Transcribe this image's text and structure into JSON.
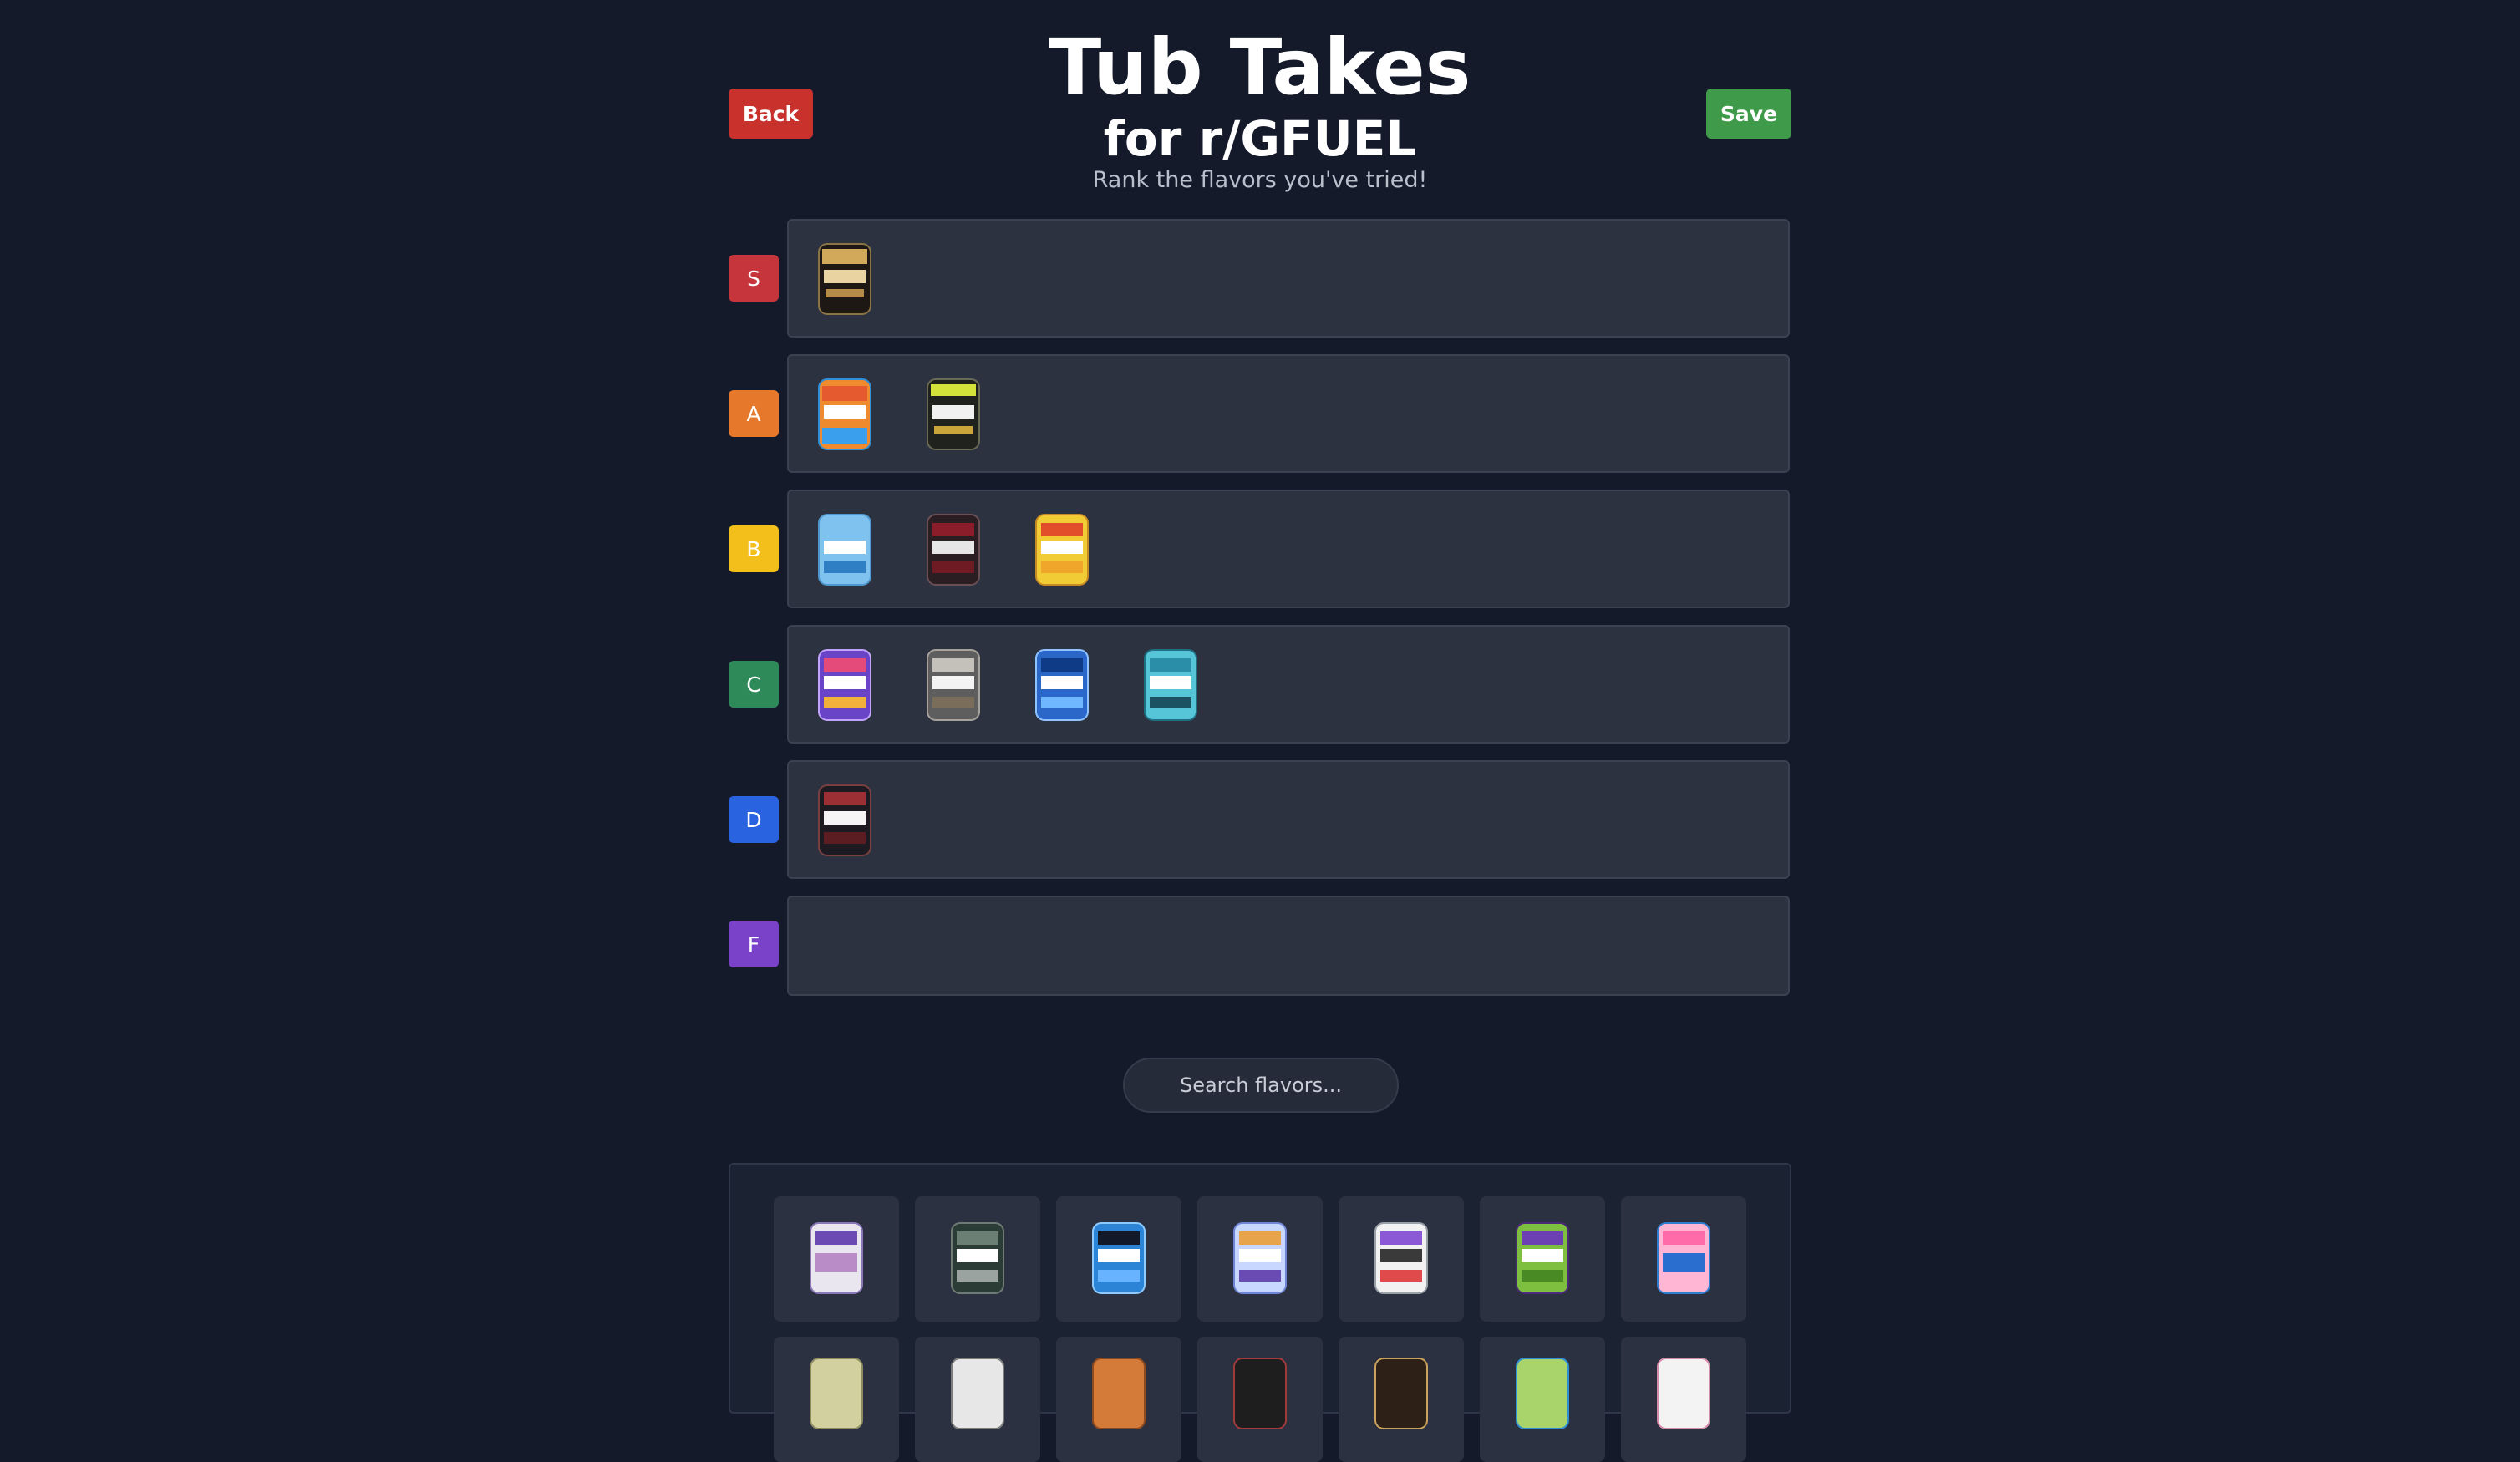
{
  "header": {
    "title": "Tub Takes",
    "subtitle": "for r/GFUEL",
    "tagline": "Rank the flavors you've tried!",
    "back_label": "Back",
    "save_label": "Save"
  },
  "tiers": [
    {
      "label": "S",
      "color": "#c7353c",
      "items": [
        {
          "icon": "gfuel-tub-black-gold"
        }
      ]
    },
    {
      "label": "A",
      "color": "#e5782a",
      "items": [
        {
          "icon": "gfuel-tub-orange-blue"
        },
        {
          "icon": "gfuel-tub-black-yellow"
        }
      ]
    },
    {
      "label": "B",
      "color": "#f3c01b",
      "items": [
        {
          "icon": "gfuel-tub-light-blue"
        },
        {
          "icon": "gfuel-tub-dark-red"
        },
        {
          "icon": "gfuel-tub-yellow-red"
        }
      ]
    },
    {
      "label": "C",
      "color": "#2e8a58",
      "items": [
        {
          "icon": "gfuel-tub-purple-orange"
        },
        {
          "icon": "gfuel-tub-gray"
        },
        {
          "icon": "gfuel-tub-blue"
        },
        {
          "icon": "gfuel-tub-teal"
        }
      ]
    },
    {
      "label": "D",
      "color": "#2a63e0",
      "items": [
        {
          "icon": "gfuel-tub-black-red"
        }
      ]
    },
    {
      "label": "F",
      "color": "#7a42c9",
      "items": []
    }
  ],
  "search": {
    "placeholder": "Search flavors..."
  },
  "pool": {
    "items": [
      {
        "icon": "gfuel-tub-white-purple"
      },
      {
        "icon": "gfuel-tub-green-camo"
      },
      {
        "icon": "gfuel-tub-blue-anime"
      },
      {
        "icon": "gfuel-tub-lavender-cookie"
      },
      {
        "icon": "gfuel-tub-white-multicolor"
      },
      {
        "icon": "gfuel-tub-green-purple"
      },
      {
        "icon": "gfuel-tub-pink-anime"
      }
    ]
  }
}
